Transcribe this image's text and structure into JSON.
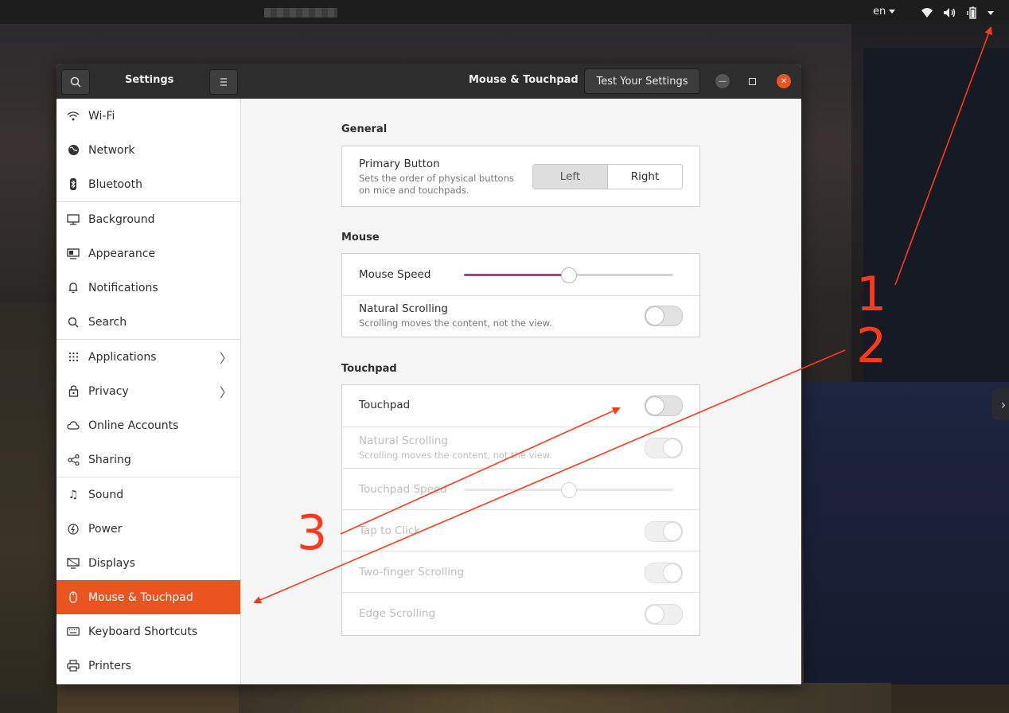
{
  "topbar": {
    "lang": "en"
  },
  "window": {
    "sidebar_title": "Settings",
    "panel_title": "Mouse & Touchpad",
    "test_button": "Test Your Settings"
  },
  "sidebar": {
    "items": [
      {
        "label": "Wi-Fi",
        "icon": "wifi-icon"
      },
      {
        "label": "Network",
        "icon": "network-icon"
      },
      {
        "label": "Bluetooth",
        "icon": "bluetooth-icon"
      },
      {
        "label": "Background",
        "icon": "background-icon"
      },
      {
        "label": "Appearance",
        "icon": "appearance-icon"
      },
      {
        "label": "Notifications",
        "icon": "bell-icon"
      },
      {
        "label": "Search",
        "icon": "search-icon"
      },
      {
        "label": "Applications",
        "icon": "grid-icon"
      },
      {
        "label": "Privacy",
        "icon": "lock-icon"
      },
      {
        "label": "Online Accounts",
        "icon": "cloud-icon"
      },
      {
        "label": "Sharing",
        "icon": "share-icon"
      },
      {
        "label": "Sound",
        "icon": "music-note-icon"
      },
      {
        "label": "Power",
        "icon": "power-icon"
      },
      {
        "label": "Displays",
        "icon": "display-icon"
      },
      {
        "label": "Mouse & Touchpad",
        "icon": "mouse-icon"
      },
      {
        "label": "Keyboard Shortcuts",
        "icon": "keyboard-icon"
      },
      {
        "label": "Printers",
        "icon": "printer-icon"
      }
    ],
    "active": "Mouse & Touchpad"
  },
  "general": {
    "title": "General",
    "primary_button_label": "Primary Button",
    "primary_button_sub_1": "Sets the order of physical buttons",
    "primary_button_sub_2": "on mice and touchpads.",
    "left": "Left",
    "right": "Right",
    "selected": "Left"
  },
  "mouse": {
    "title": "Mouse",
    "speed_label": "Mouse Speed",
    "speed_value": 0.5,
    "natural_label": "Natural Scrolling",
    "natural_sub": "Scrolling moves the content, not the view.",
    "natural_on": false
  },
  "touchpad": {
    "title": "Touchpad",
    "touchpad_label": "Touchpad",
    "touchpad_on": false,
    "natural_label": "Natural Scrolling",
    "natural_sub": "Scrolling moves the content, not the view.",
    "speed_label": "Touchpad Speed",
    "speed_value": 0.5,
    "tap_label": "Tap to Click",
    "twofinger_label": "Two-finger Scrolling",
    "edge_label": "Edge Scrolling"
  },
  "annotations": {
    "n1": "1",
    "n2": "2",
    "n3": "3",
    "color": "#ff3a1a"
  }
}
